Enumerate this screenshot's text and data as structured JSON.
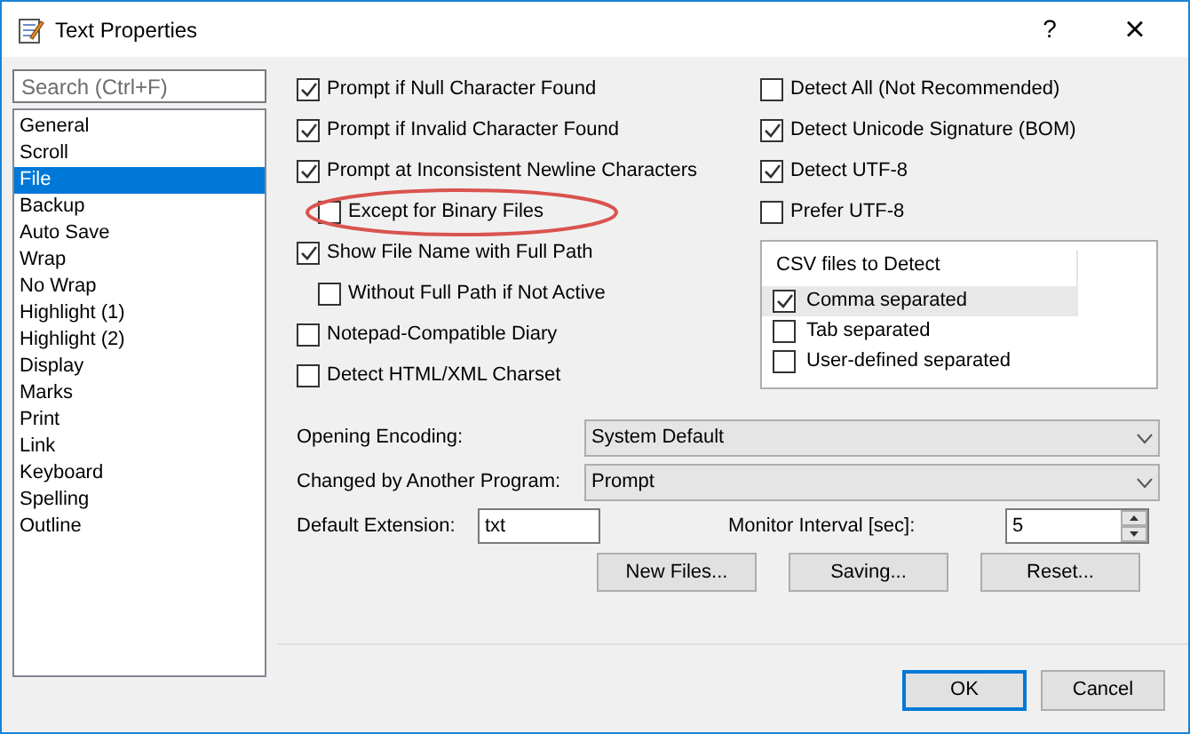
{
  "window": {
    "title": "Text Properties",
    "help": "?",
    "close": "×"
  },
  "search": {
    "placeholder": "Search (Ctrl+F)"
  },
  "sidebar": {
    "items": [
      {
        "label": "General",
        "selected": false
      },
      {
        "label": "Scroll",
        "selected": false
      },
      {
        "label": "File",
        "selected": true
      },
      {
        "label": "Backup",
        "selected": false
      },
      {
        "label": "Auto Save",
        "selected": false
      },
      {
        "label": "Wrap",
        "selected": false
      },
      {
        "label": "No Wrap",
        "selected": false
      },
      {
        "label": "Highlight (1)",
        "selected": false
      },
      {
        "label": "Highlight (2)",
        "selected": false
      },
      {
        "label": "Display",
        "selected": false
      },
      {
        "label": "Marks",
        "selected": false
      },
      {
        "label": "Print",
        "selected": false
      },
      {
        "label": "Link",
        "selected": false
      },
      {
        "label": "Keyboard",
        "selected": false
      },
      {
        "label": "Spelling",
        "selected": false
      },
      {
        "label": "Outline",
        "selected": false
      }
    ]
  },
  "left_options": [
    {
      "label": "Prompt if Null Character Found",
      "checked": true
    },
    {
      "label": "Prompt if Invalid Character Found",
      "checked": true
    },
    {
      "label": "Prompt at Inconsistent Newline Characters",
      "checked": true,
      "children": [
        {
          "label": "Except for Binary Files",
          "checked": false,
          "highlighted": true
        }
      ]
    },
    {
      "label": "Show File Name with Full Path",
      "checked": true,
      "children": [
        {
          "label": "Without Full Path if Not Active",
          "checked": false,
          "highlighted": false
        }
      ]
    },
    {
      "label": "Notepad-Compatible Diary",
      "checked": false
    },
    {
      "label": "Detect HTML/XML Charset",
      "checked": false
    }
  ],
  "right_options": [
    {
      "label": "Detect All (Not Recommended)",
      "checked": false
    },
    {
      "label": "Detect Unicode Signature (BOM)",
      "checked": true
    },
    {
      "label": "Detect UTF-8",
      "checked": true
    },
    {
      "label": "Prefer UTF-8",
      "checked": false
    }
  ],
  "csv": {
    "title": "CSV files to Detect",
    "items": [
      {
        "label": "Comma separated",
        "checked": true,
        "selected": true
      },
      {
        "label": "Tab separated",
        "checked": false,
        "selected": false
      },
      {
        "label": "User-defined separated",
        "checked": false,
        "selected": false
      }
    ]
  },
  "dropdowns": [
    {
      "label": "Opening Encoding:",
      "value": "System Default"
    },
    {
      "label": "Changed by Another Program:",
      "value": "Prompt"
    }
  ],
  "default_extension": {
    "label": "Default Extension:",
    "value": "txt"
  },
  "monitor_interval": {
    "label": "Monitor Interval [sec]:",
    "value": "5"
  },
  "action_buttons": [
    "New Files...",
    "Saving...",
    "Reset..."
  ],
  "footer_buttons": [
    {
      "label": "OK",
      "default": true
    },
    {
      "label": "Cancel",
      "default": false
    }
  ]
}
